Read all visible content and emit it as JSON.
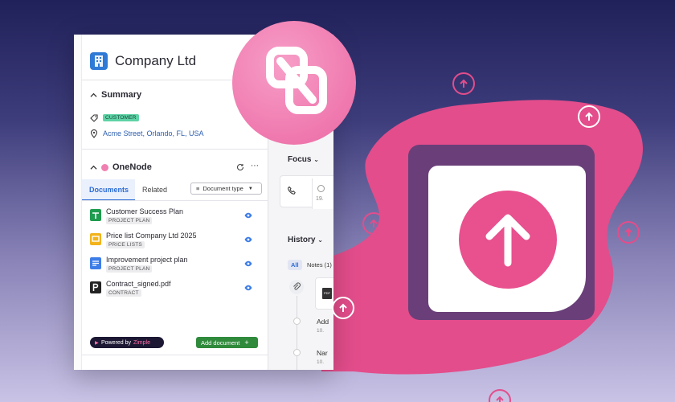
{
  "company": {
    "name": "Company Ltd"
  },
  "summary": {
    "title": "Summary",
    "badge": "CUSTOMER",
    "address": "Acme Street, Orlando, FL, USA"
  },
  "onenode": {
    "title": "OneNode",
    "tabs": [
      {
        "label": "Documents",
        "active": true
      },
      {
        "label": "Related",
        "active": false
      }
    ],
    "filter_label": "Document type",
    "documents": [
      {
        "name": "Customer Success Plan",
        "category": "PROJECT PLAN",
        "icon": "sheets-icon",
        "color": "#1e9c4f"
      },
      {
        "name": "Price list Company Ltd 2025",
        "category": "PRICE LISTS",
        "icon": "slides-icon",
        "color": "#f2b31b"
      },
      {
        "name": "Improvement project plan",
        "category": "PROJECT PLAN",
        "icon": "docs-icon",
        "color": "#3d7de8"
      },
      {
        "name": "Contract_signed.pdf",
        "category": "CONTRACT",
        "icon": "pdf-icon",
        "color": "#222222"
      }
    ],
    "powered_prefix": "Powered by",
    "powered_brand": "Zimple",
    "add_document": "Add document"
  },
  "right_pane": {
    "focus_title": "Focus",
    "focus_date": "19.",
    "history_title": "History",
    "history_tabs": [
      "All",
      "Notes (1)"
    ],
    "history_items": [
      {
        "label": "Add",
        "date": "10."
      },
      {
        "label": "Nar",
        "date": "10."
      }
    ],
    "file_badge": "PDF"
  },
  "colors": {
    "brand_pink": "#e8508e",
    "accent_blue": "#2d6bd4",
    "add_green": "#2f8a3b"
  }
}
